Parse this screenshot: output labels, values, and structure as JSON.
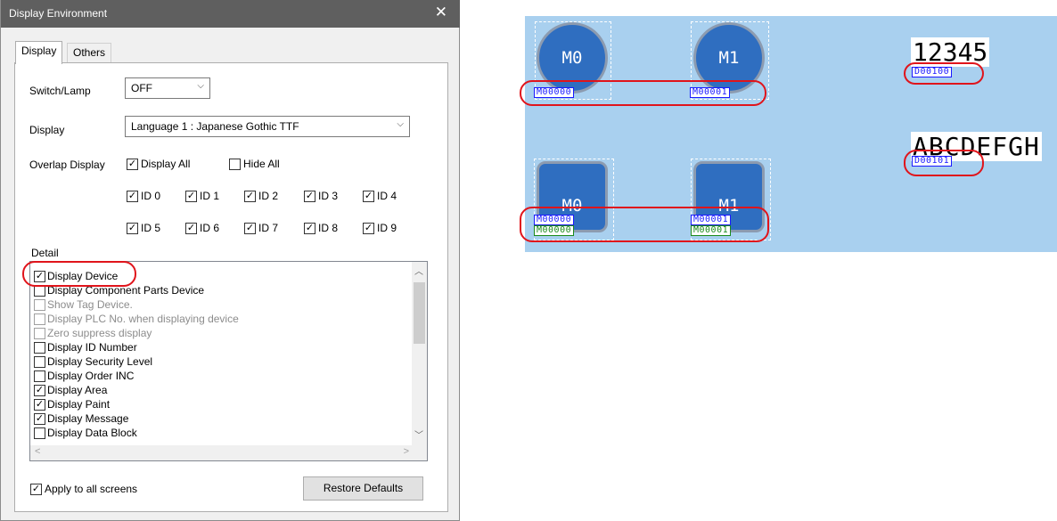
{
  "dialog": {
    "title": "Display Environment",
    "close_glyph": "✕",
    "tabs": [
      {
        "label": "Display",
        "active": true
      },
      {
        "label": "Others",
        "active": false
      }
    ],
    "switch_lamp": {
      "label": "Switch/Lamp",
      "value": "OFF"
    },
    "display": {
      "label": "Display",
      "value": "Language 1 : Japanese Gothic TTF"
    },
    "overlap": {
      "label": "Overlap Display",
      "display_all": {
        "label": "Display All",
        "checked": true
      },
      "hide_all": {
        "label": "Hide All",
        "checked": false
      },
      "ids": [
        {
          "label": "ID 0",
          "checked": true
        },
        {
          "label": "ID 1",
          "checked": true
        },
        {
          "label": "ID 2",
          "checked": true
        },
        {
          "label": "ID 3",
          "checked": true
        },
        {
          "label": "ID 4",
          "checked": true
        },
        {
          "label": "ID 5",
          "checked": true
        },
        {
          "label": "ID 6",
          "checked": true
        },
        {
          "label": "ID 7",
          "checked": true
        },
        {
          "label": "ID 8",
          "checked": true
        },
        {
          "label": "ID 9",
          "checked": true
        }
      ]
    },
    "detail": {
      "label": "Detail",
      "items": [
        {
          "label": "Display Device",
          "checked": true,
          "enabled": true
        },
        {
          "label": "Display Component Parts Device",
          "checked": false,
          "enabled": true
        },
        {
          "label": "Show Tag Device.",
          "checked": false,
          "enabled": false
        },
        {
          "label": "Display PLC No. when displaying device",
          "checked": false,
          "enabled": false
        },
        {
          "label": "Zero suppress display",
          "checked": false,
          "enabled": false
        },
        {
          "label": "Display ID Number",
          "checked": false,
          "enabled": true
        },
        {
          "label": "Display Security Level",
          "checked": false,
          "enabled": true
        },
        {
          "label": "Display Order INC",
          "checked": false,
          "enabled": true
        },
        {
          "label": "Display Area",
          "checked": true,
          "enabled": true
        },
        {
          "label": "Display Paint",
          "checked": true,
          "enabled": true
        },
        {
          "label": "Display Message",
          "checked": true,
          "enabled": true
        },
        {
          "label": "Display Data Block",
          "checked": false,
          "enabled": true
        }
      ]
    },
    "apply_all": {
      "label": "Apply to all screens",
      "checked": true
    },
    "restore_label": "Restore Defaults",
    "check_glyph": "✓",
    "dropdown_glyph": "⌵",
    "scroll_up_glyph": "︿",
    "scroll_down_glyph": "﹀",
    "scroll_left_glyph": "<",
    "scroll_right_glyph": ">"
  },
  "preview": {
    "lamps": [
      {
        "label": "M0",
        "device": "M00000"
      },
      {
        "label": "M1",
        "device": "M00001"
      }
    ],
    "buttons": [
      {
        "label": "M0",
        "device_blue": "M00000",
        "device_green": "M00000"
      },
      {
        "label": "M1",
        "device_blue": "M00001",
        "device_green": "M00001"
      }
    ],
    "numeric": {
      "value": "12345",
      "device": "D00100"
    },
    "text": {
      "value": "ABCDEFGH",
      "device": "D00101"
    }
  },
  "colors": {
    "highlight_ring": "#e0141b",
    "preview_bg": "#a9d0ef",
    "part_fill": "#2f6ec0",
    "tag_blue": "#1a1aff",
    "tag_green": "#1a8a1a"
  }
}
